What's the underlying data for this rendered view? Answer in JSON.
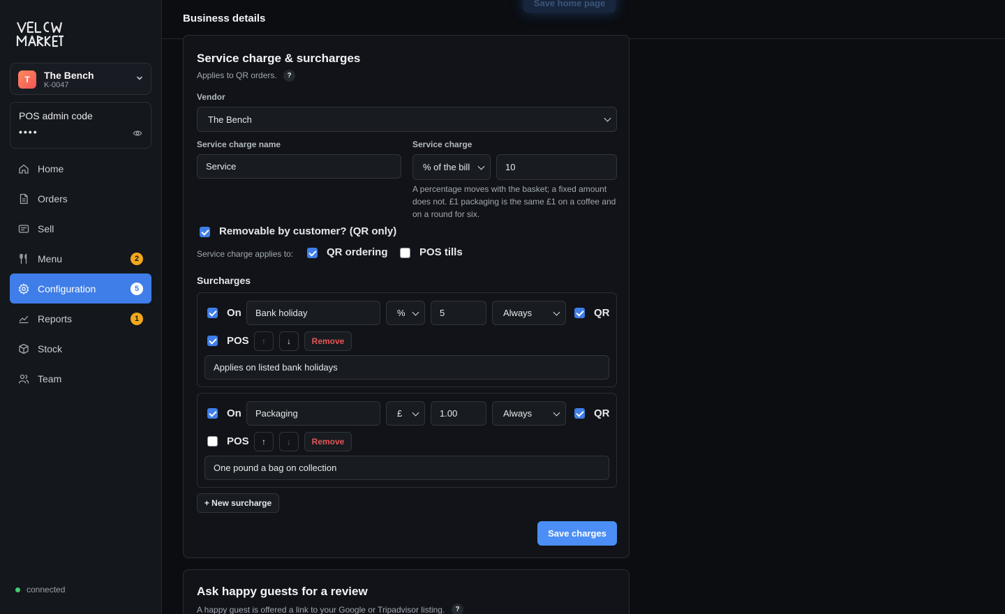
{
  "sidebar": {
    "vendor": {
      "initial": "T",
      "name": "The Bench",
      "code": "K-0047"
    },
    "pos": {
      "label": "POS admin code",
      "masked": "••••"
    },
    "nav": [
      {
        "label": "Home",
        "icon": "home-icon"
      },
      {
        "label": "Orders",
        "icon": "document-icon"
      },
      {
        "label": "Sell",
        "icon": "register-icon"
      },
      {
        "label": "Menu",
        "icon": "utensils-icon",
        "badge": "2"
      },
      {
        "label": "Configuration",
        "icon": "gear-icon",
        "badge": "5",
        "active": true
      },
      {
        "label": "Reports",
        "icon": "chart-icon",
        "badge": "1"
      },
      {
        "label": "Stock",
        "icon": "box-icon"
      },
      {
        "label": "Team",
        "icon": "users-icon"
      }
    ],
    "status": "connected"
  },
  "header": {
    "title": "Business details",
    "ghost_button": "Save home page"
  },
  "service": {
    "title": "Service charge & surcharges",
    "subtitle": "Applies to QR orders.",
    "help": "?",
    "vendor_label": "Vendor",
    "vendor_value": "The Bench",
    "name_label": "Service charge name",
    "name_value": "Service",
    "charge_label": "Service charge",
    "charge_type": "% of the bill",
    "charge_value": "10",
    "note": "A percentage moves with the basket; a fixed amount does not. £1 packaging is the same £1 on a coffee and on a round for six.",
    "removable_label": "Removable by customer? (QR only)",
    "applies_label": "Service charge applies to:",
    "applies_qr": "QR ordering",
    "applies_pos": "POS tills"
  },
  "surcharges": {
    "title": "Surcharges",
    "items": [
      {
        "on_label": "On",
        "name": "Bank holiday",
        "unit": "%",
        "amount": "5",
        "when": "Always",
        "qr_label": "QR",
        "pos_label": "POS",
        "up": "↑",
        "down": "↓",
        "remove": "Remove",
        "description": "Applies on listed bank holidays"
      },
      {
        "on_label": "On",
        "name": "Packaging",
        "unit": "£",
        "amount": "1.00",
        "when": "Always",
        "qr_label": "QR",
        "pos_label": "POS",
        "up": "↑",
        "down": "↓",
        "remove": "Remove",
        "description": "One pound a bag on collection"
      }
    ],
    "new_button": "+ New surcharge",
    "save_button": "Save charges"
  },
  "review": {
    "title": "Ask happy guests for a review",
    "subtitle": "A happy guest is offered a link to your Google or Tripadvisor listing.",
    "help": "?"
  },
  "colors": {
    "accent": "#3f7ee8",
    "badge": "#f2a81d",
    "danger": "#e85656",
    "status": "#3ecf6e"
  }
}
